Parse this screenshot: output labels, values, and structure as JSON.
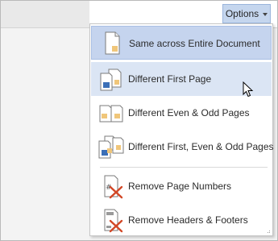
{
  "ribbon": {
    "options_label": "Options",
    "options_caret_icon": "chevron-down-icon"
  },
  "menu": {
    "items": [
      {
        "label": "Same across Entire Document",
        "icon": "same-across-document-icon",
        "state": "selected"
      },
      {
        "label": "Different First Page",
        "icon": "different-first-page-icon",
        "state": "hover"
      },
      {
        "label": "Different Even & Odd Pages",
        "icon": "different-even-odd-icon",
        "state": "normal"
      },
      {
        "label": "Different First, Even & Odd Pages",
        "icon": "different-first-even-odd-icon",
        "state": "normal"
      },
      {
        "label": "Remove Page Numbers",
        "icon": "remove-page-numbers-icon",
        "state": "normal"
      },
      {
        "label": "Remove Headers & Footers",
        "icon": "remove-headers-footers-icon",
        "state": "normal"
      }
    ]
  },
  "colors": {
    "selected_bg": "#c5d4ee",
    "hover_bg": "#dbe5f4",
    "page_accent": "#f0c67a",
    "page_blue": "#3b6fb7",
    "remove_x": "#d24726"
  },
  "cursor_icon": "mouse-pointer-icon"
}
